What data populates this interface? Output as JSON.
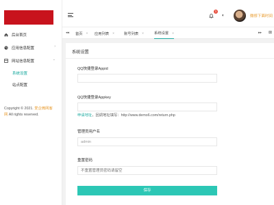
{
  "sidebar": {
    "items": [
      {
        "label": "后台首页",
        "icon": "home-icon"
      },
      {
        "label": "应用信息配置",
        "icon": "palette-icon"
      },
      {
        "label": "网站信息配置",
        "icon": "grid-icon"
      }
    ],
    "submenu": [
      {
        "label": "系统设置",
        "active": true
      },
      {
        "label": "站点配置",
        "active": false
      }
    ],
    "copyright_prefix": "Copyright © 2021.",
    "copyright_brand": "爱企微网客",
    "copyright_brand2": "网",
    "copyright_suffix": "All rights reserved."
  },
  "header": {
    "notification_count": "1",
    "username": "微修下面时间"
  },
  "tabs": [
    {
      "label": "首页"
    },
    {
      "label": "应用列表"
    },
    {
      "label": "账号列表"
    },
    {
      "label": "系统设置"
    }
  ],
  "panel": {
    "title": "系统设置",
    "fields": [
      {
        "label": "QQ快捷登录Appid",
        "value": "",
        "placeholder": ""
      },
      {
        "label": "QQ快捷登录Appkey",
        "value": "",
        "placeholder": ""
      },
      {
        "label": "管理员用户名",
        "value": "admin",
        "placeholder": ""
      },
      {
        "label": "重置密码",
        "value": "",
        "placeholder": "不重置管理员密码请留空"
      }
    ],
    "hint_link": "申请地址",
    "hint_text": "，回调地址填写：http://www.demo6.com/return.php",
    "save_label": "保存"
  },
  "colors": {
    "accent": "#1aa99f",
    "button": "#2cc7b5",
    "brand": "#c8131d",
    "highlight": "#e89a2c"
  }
}
